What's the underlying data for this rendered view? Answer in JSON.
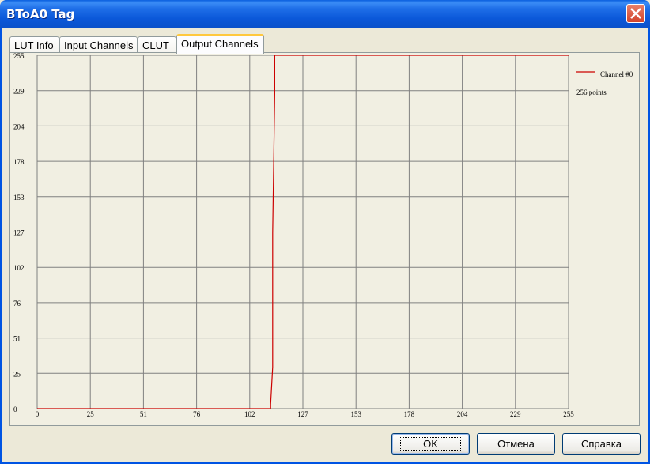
{
  "window": {
    "title": "BToA0 Tag"
  },
  "tabs": [
    {
      "label": "LUT Info"
    },
    {
      "label": "Input Channels"
    },
    {
      "label": "CLUT"
    },
    {
      "label": "Output Channels"
    }
  ],
  "active_tab": "Output Channels",
  "legend": {
    "series_name": "Channel #0",
    "points_label": "256 points",
    "color": "#cc0000"
  },
  "buttons": {
    "ok": "OK",
    "cancel": "Отмена",
    "help": "Справка"
  },
  "chart_data": {
    "type": "line",
    "xlim": [
      0,
      255
    ],
    "ylim": [
      0,
      255
    ],
    "x_ticks": [
      "0",
      "25",
      "51",
      "76",
      "102",
      "127",
      "153",
      "178",
      "204",
      "229",
      "255"
    ],
    "y_ticks": [
      "0",
      "25",
      "51",
      "76",
      "102",
      "127",
      "153",
      "178",
      "204",
      "229",
      "255"
    ],
    "grid": true,
    "legend_position": "right",
    "series": [
      {
        "name": "Channel #0",
        "color": "#cc0000",
        "points": [
          [
            0,
            0
          ],
          [
            112,
            0
          ],
          [
            112,
            3
          ],
          [
            113,
            30
          ],
          [
            113,
            127
          ],
          [
            114,
            228
          ],
          [
            114,
            255
          ],
          [
            255,
            255
          ]
        ]
      }
    ]
  }
}
